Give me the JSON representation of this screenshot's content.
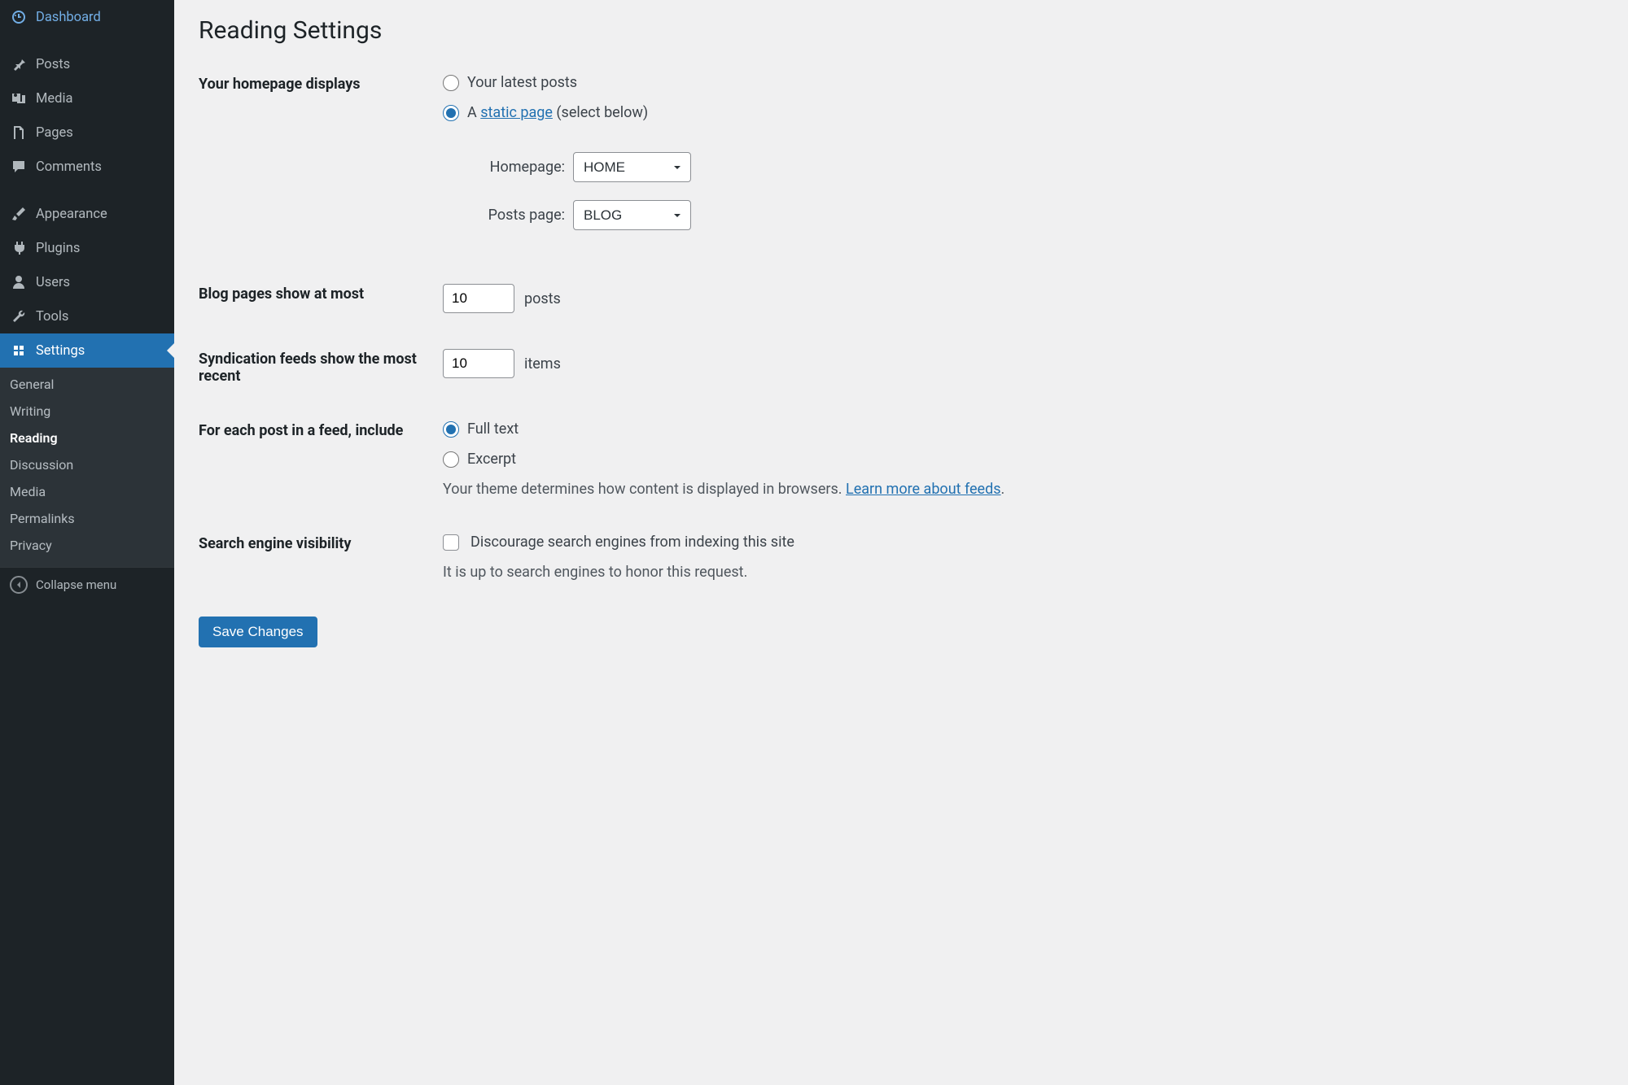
{
  "sidebar": {
    "items": [
      {
        "label": "Dashboard"
      },
      {
        "label": "Posts"
      },
      {
        "label": "Media"
      },
      {
        "label": "Pages"
      },
      {
        "label": "Comments"
      },
      {
        "label": "Appearance"
      },
      {
        "label": "Plugins"
      },
      {
        "label": "Users"
      },
      {
        "label": "Tools"
      },
      {
        "label": "Settings"
      }
    ],
    "submenu": [
      {
        "label": "General"
      },
      {
        "label": "Writing"
      },
      {
        "label": "Reading"
      },
      {
        "label": "Discussion"
      },
      {
        "label": "Media"
      },
      {
        "label": "Permalinks"
      },
      {
        "label": "Privacy"
      }
    ],
    "collapse_label": "Collapse menu"
  },
  "page": {
    "title": "Reading Settings",
    "homepage": {
      "label": "Your homepage displays",
      "option_latest": "Your latest posts",
      "option_static_prefix": "A ",
      "option_static_link": "static page",
      "option_static_suffix": " (select below)",
      "homepage_label": "Homepage:",
      "homepage_value": "HOME",
      "postspage_label": "Posts page:",
      "postspage_value": "BLOG"
    },
    "blog_pages": {
      "label": "Blog pages show at most",
      "value": "10",
      "unit": "posts"
    },
    "syndication": {
      "label": "Syndication feeds show the most recent",
      "value": "10",
      "unit": "items"
    },
    "feed_content": {
      "label": "For each post in a feed, include",
      "option_full": "Full text",
      "option_excerpt": "Excerpt",
      "desc_prefix": "Your theme determines how content is displayed in browsers. ",
      "desc_link": "Learn more about feeds",
      "desc_suffix": "."
    },
    "search": {
      "label": "Search engine visibility",
      "checkbox_label": "Discourage search engines from indexing this site",
      "desc": "It is up to search engines to honor this request."
    },
    "save_label": "Save Changes"
  }
}
